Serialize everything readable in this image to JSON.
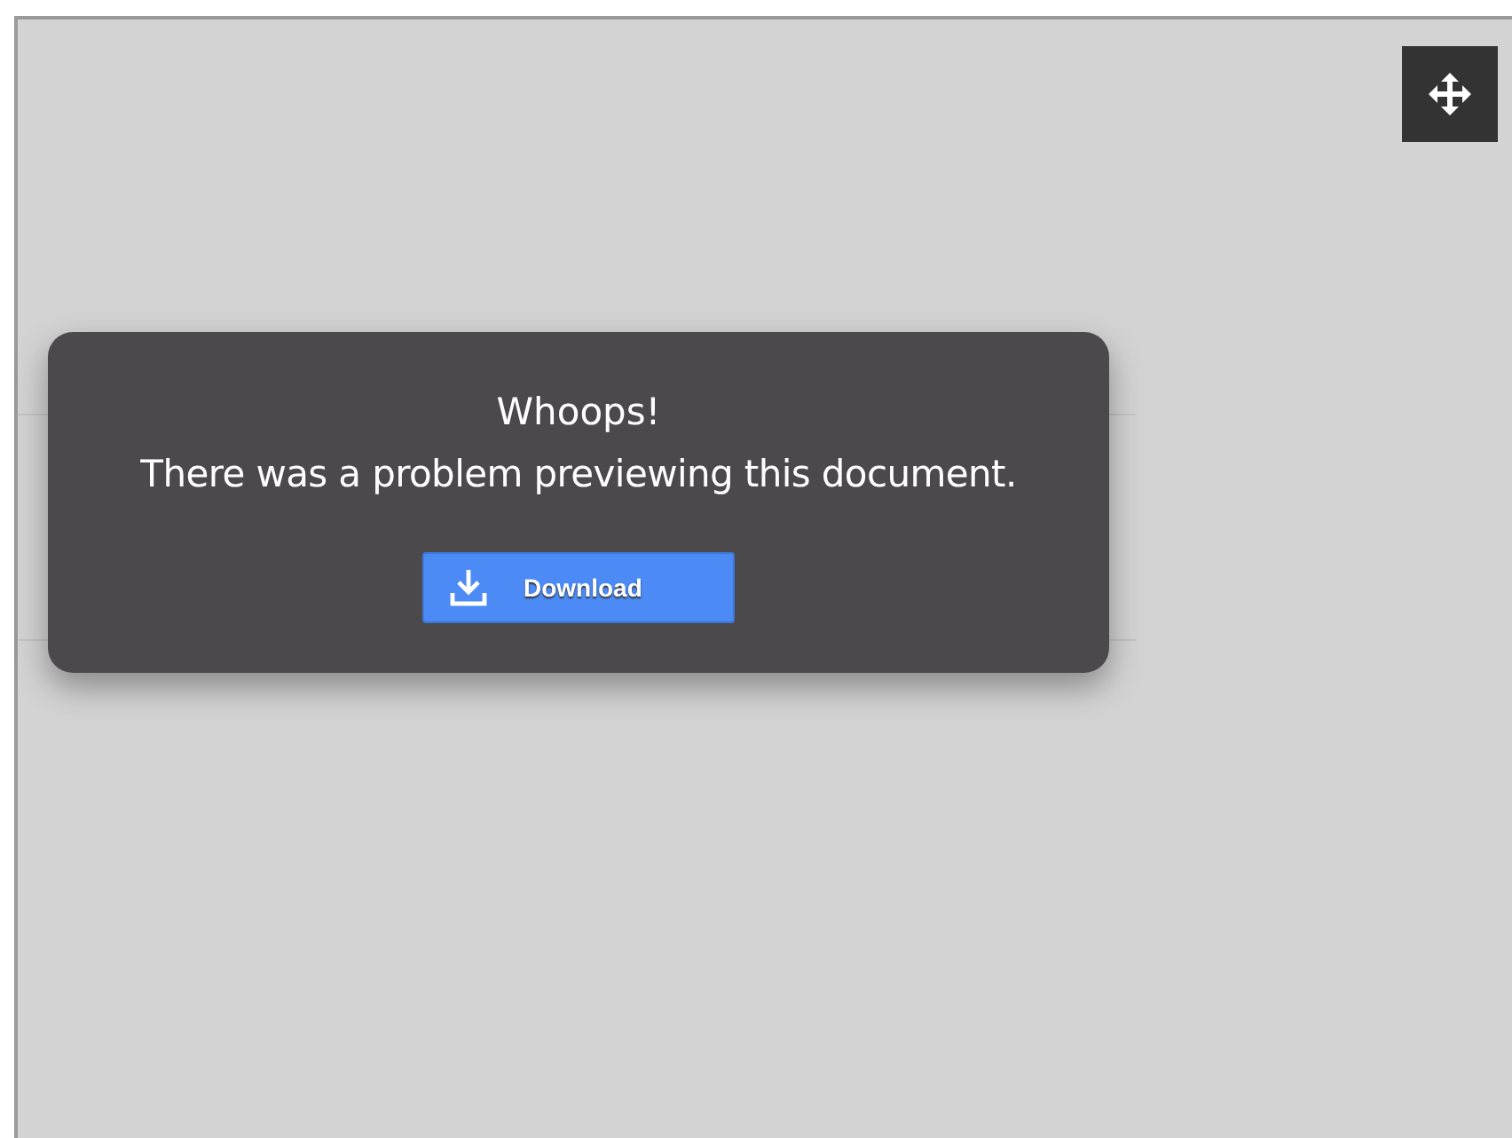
{
  "dialog": {
    "title": "Whoops!",
    "message": "There was a problem previewing this document.",
    "button": "Download"
  }
}
